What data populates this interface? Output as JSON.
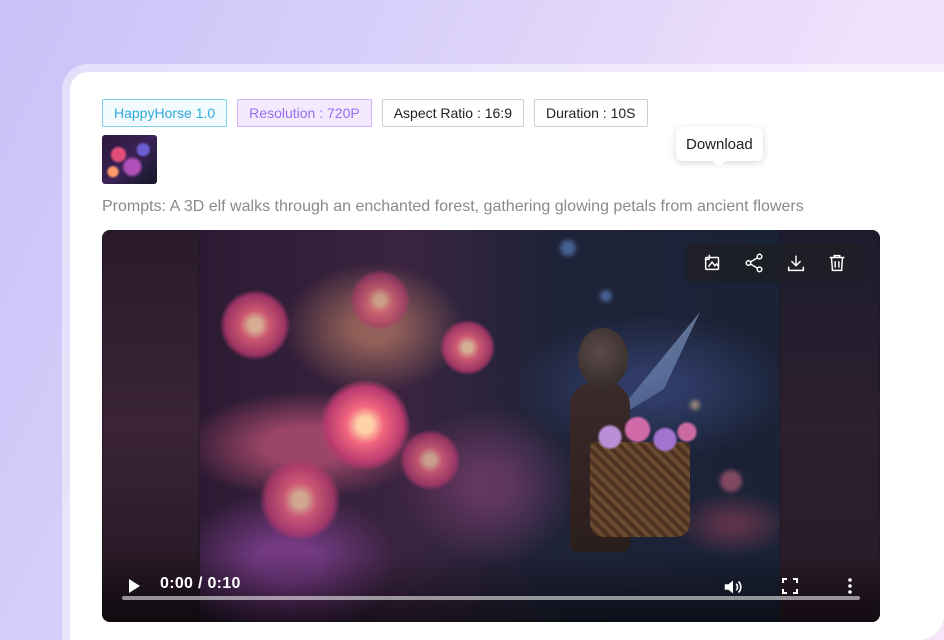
{
  "tags": {
    "model": "HappyHorse 1.0",
    "resolution": "Resolution : 720P",
    "aspect_ratio": "Aspect Ratio : 16:9",
    "duration": "Duration : 10S"
  },
  "prompt": "Prompts: A 3D elf walks through an enchanted forest, gathering glowing petals from ancient flowers",
  "tooltip": "Download",
  "toolbar": {
    "icons": [
      "crop-image-icon",
      "share-icon",
      "download-icon",
      "trash-icon"
    ]
  },
  "player": {
    "time": "0:00 / 0:10",
    "progress": 0
  },
  "colors": {
    "model_tag": "#2fa9d8",
    "resolution_tag": "#9a6cf0",
    "toolbar_bg": "#1e1e24"
  }
}
